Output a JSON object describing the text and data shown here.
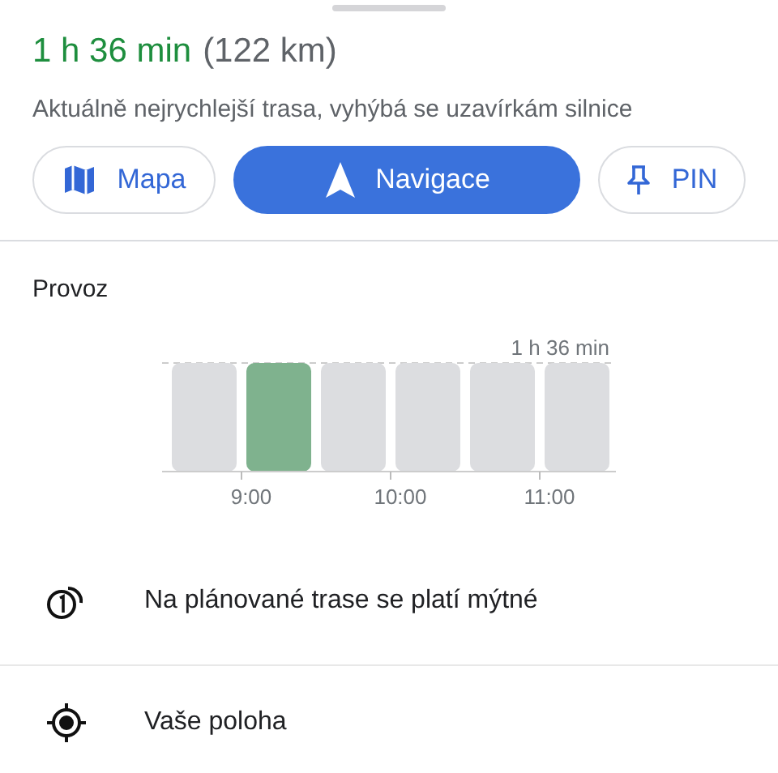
{
  "route": {
    "duration": "1 h 36 min",
    "distance": "(122 km)",
    "description": "Aktuálně nejrychlejší trasa, vyhýbá se uzavírkám silnice"
  },
  "buttons": [
    {
      "kind": "map",
      "label": "Mapa"
    },
    {
      "kind": "navigate",
      "label": "Navigace"
    },
    {
      "kind": "pin",
      "label": "PIN"
    }
  ],
  "traffic": {
    "title": "Provoz",
    "max_label": "1 h 36 min",
    "bars": [
      {
        "selected": false
      },
      {
        "selected": true
      },
      {
        "selected": false
      },
      {
        "selected": false
      },
      {
        "selected": false
      },
      {
        "selected": false
      }
    ],
    "time_labels": [
      "9:00",
      "10:00",
      "11:00"
    ]
  },
  "info_rows": [
    {
      "kind": "toll",
      "text": "Na plánované trase se platí mýtné"
    },
    {
      "kind": "location",
      "text": "Vaše poloha"
    }
  ]
}
